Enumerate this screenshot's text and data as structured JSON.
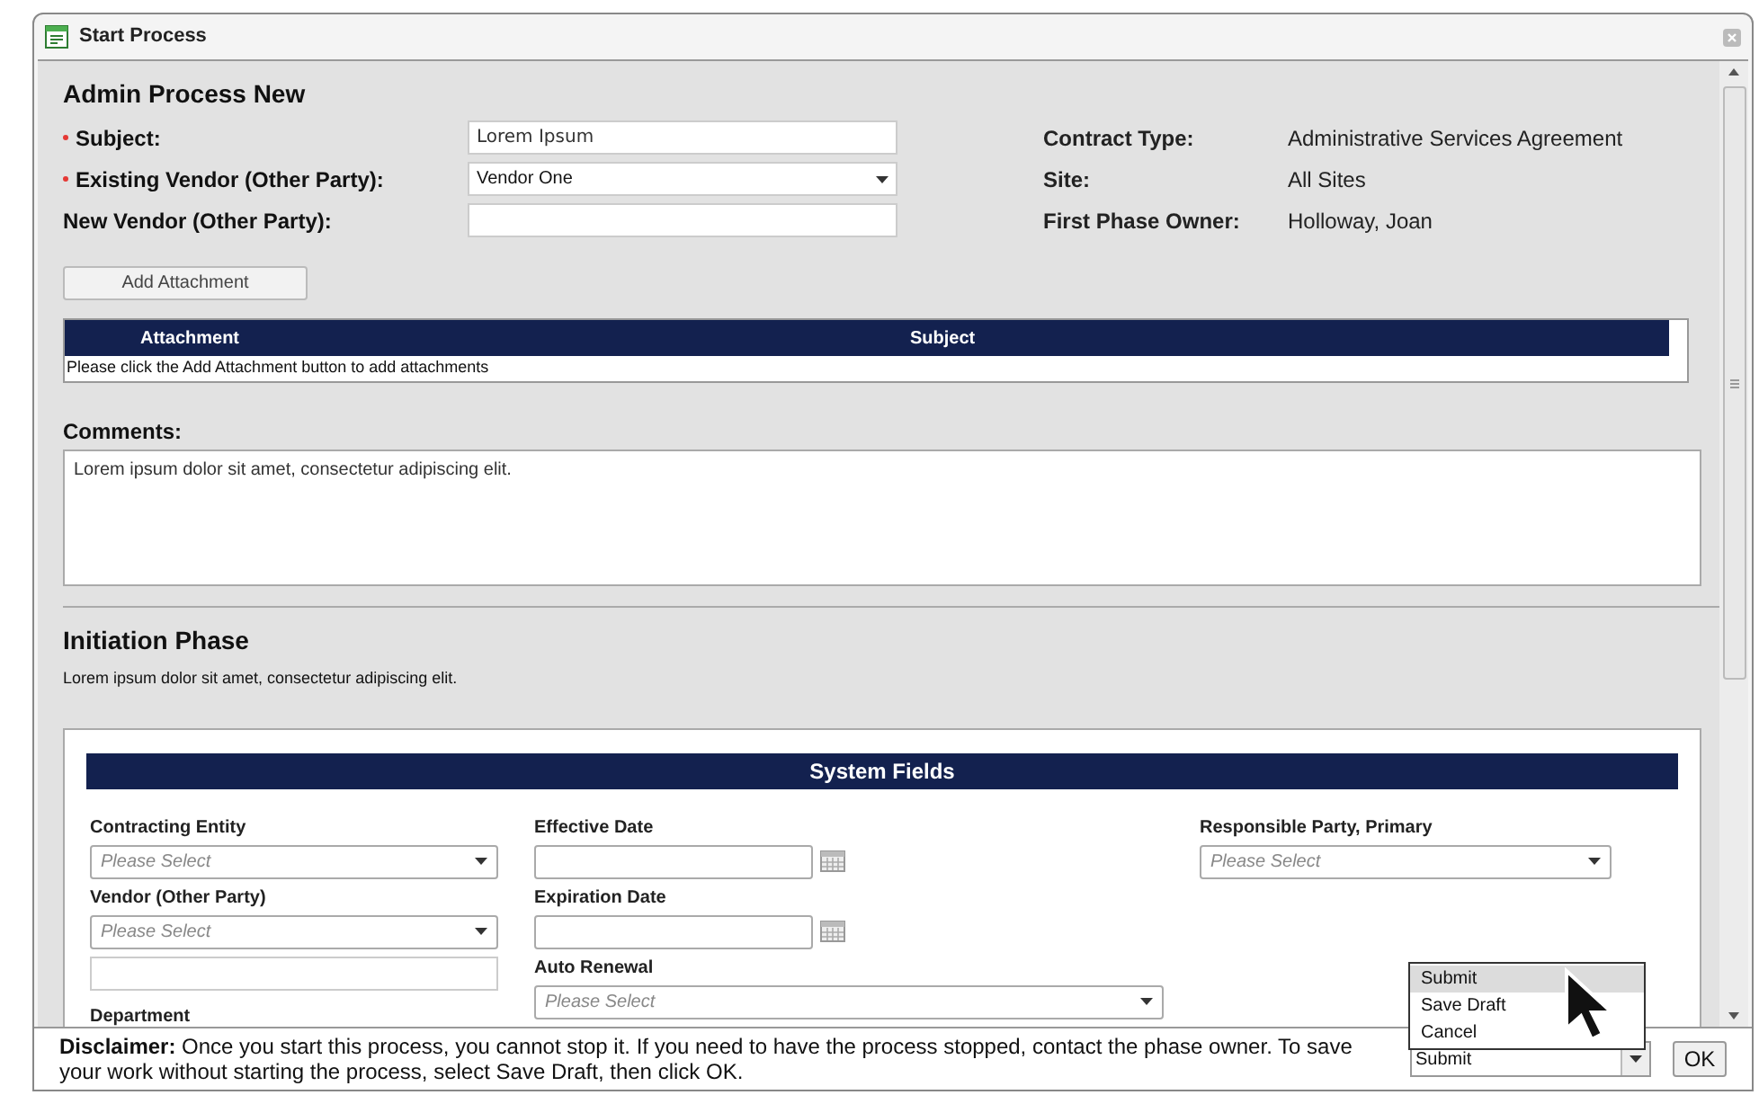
{
  "window": {
    "title": "Start Process"
  },
  "header": {
    "title": "Admin Process New"
  },
  "fields": [
    {
      "label": "Subject:",
      "required": true,
      "kind": "text",
      "value": "Lorem Ipsum"
    },
    {
      "label": "Existing Vendor (Other Party):",
      "required": true,
      "kind": "select",
      "value": "Vendor One"
    },
    {
      "label": "New Vendor (Other Party):",
      "required": false,
      "kind": "text"
    }
  ],
  "info": [
    {
      "label": "Contract Type:",
      "value": "Administrative Services Agreement"
    },
    {
      "label": "Site:",
      "value": "All Sites"
    },
    {
      "label": "First Phase Owner:",
      "value": "Holloway, Joan"
    }
  ],
  "attachment_button": "Add Attachment",
  "attachments": {
    "columns": [
      "Attachment",
      "Subject"
    ],
    "empty_message": "Please click the Add Attachment button to add attachments"
  },
  "comments": {
    "label": "Comments:",
    "value": "Lorem ipsum dolor sit amet, consectetur adipiscing elit."
  },
  "initiation": {
    "title": "Initiation Phase",
    "description": "Lorem ipsum dolor sit amet, consectetur adipiscing elit."
  },
  "system_fields": {
    "title": "System Fields",
    "columns": [
      [
        {
          "kind": "select",
          "label": "Contracting Entity",
          "placeholder": "Please Select"
        },
        {
          "kind": "select",
          "label": "Vendor (Other Party)",
          "placeholder": "Please Select"
        },
        {
          "kind": "text"
        },
        {
          "kind": "label",
          "label": "Department"
        }
      ],
      [
        {
          "kind": "date",
          "label": "Effective Date"
        },
        {
          "kind": "date",
          "label": "Expiration Date"
        },
        {
          "kind": "select",
          "label": "Auto Renewal",
          "placeholder": "Please Select"
        }
      ],
      [
        {
          "kind": "select",
          "label": "Responsible Party, Primary",
          "placeholder": "Please Select"
        }
      ]
    ]
  },
  "footer": {
    "disclaimer": "**Disclaimer:** Once you start this process, you cannot stop it. If you need to have the process stopped, contact the phase owner. To save your work without starting the process, select Save Draft, then click OK.",
    "action_value": "Submit",
    "action_options": [
      {
        "label": "Submit",
        "selected": true
      },
      {
        "label": "Save Draft",
        "selected": false
      },
      {
        "label": "Cancel",
        "selected": false
      }
    ],
    "ok_button": "OK"
  }
}
